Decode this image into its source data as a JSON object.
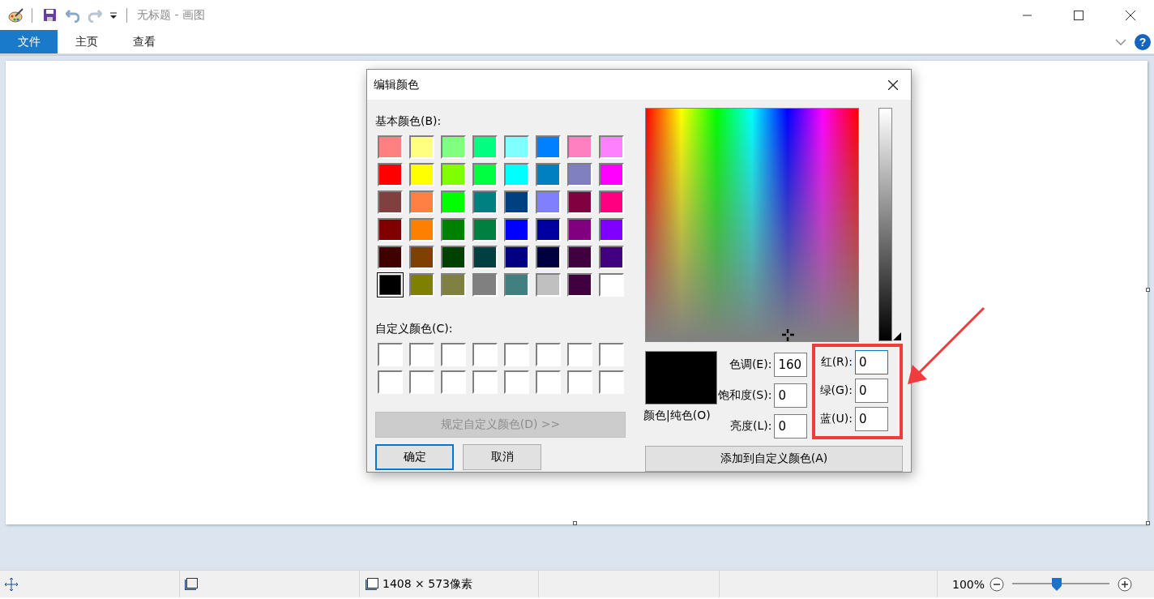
{
  "window": {
    "title": "无标题 - 画图",
    "help_label": "?"
  },
  "ribbon_tabs": [
    {
      "label": "文件",
      "selected": true
    },
    {
      "label": "主页",
      "selected": false
    },
    {
      "label": "查看",
      "selected": false
    }
  ],
  "dialog": {
    "title": "编辑颜色",
    "basic_colors_label": "基本颜色(B):",
    "basic_colors": [
      {
        "color": "#ff8080",
        "selected": false
      },
      {
        "color": "#ffff80",
        "selected": false
      },
      {
        "color": "#80ff80",
        "selected": false
      },
      {
        "color": "#00ff80",
        "selected": false
      },
      {
        "color": "#80ffff",
        "selected": false
      },
      {
        "color": "#0080ff",
        "selected": false
      },
      {
        "color": "#ff80c0",
        "selected": false
      },
      {
        "color": "#ff80ff",
        "selected": false
      },
      {
        "color": "#ff0000",
        "selected": false
      },
      {
        "color": "#ffff00",
        "selected": false
      },
      {
        "color": "#80ff00",
        "selected": false
      },
      {
        "color": "#00ff40",
        "selected": false
      },
      {
        "color": "#00ffff",
        "selected": false
      },
      {
        "color": "#0080c0",
        "selected": false
      },
      {
        "color": "#8080c0",
        "selected": false
      },
      {
        "color": "#ff00ff",
        "selected": false
      },
      {
        "color": "#804040",
        "selected": false
      },
      {
        "color": "#ff8040",
        "selected": false
      },
      {
        "color": "#00ff00",
        "selected": false
      },
      {
        "color": "#008080",
        "selected": false
      },
      {
        "color": "#004080",
        "selected": false
      },
      {
        "color": "#8080ff",
        "selected": false
      },
      {
        "color": "#800040",
        "selected": false
      },
      {
        "color": "#ff0080",
        "selected": false
      },
      {
        "color": "#800000",
        "selected": false
      },
      {
        "color": "#ff8000",
        "selected": false
      },
      {
        "color": "#008000",
        "selected": false
      },
      {
        "color": "#008040",
        "selected": false
      },
      {
        "color": "#0000ff",
        "selected": false
      },
      {
        "color": "#0000a0",
        "selected": false
      },
      {
        "color": "#800080",
        "selected": false
      },
      {
        "color": "#8000ff",
        "selected": false
      },
      {
        "color": "#400000",
        "selected": false
      },
      {
        "color": "#804000",
        "selected": false
      },
      {
        "color": "#004000",
        "selected": false
      },
      {
        "color": "#004040",
        "selected": false
      },
      {
        "color": "#000080",
        "selected": false
      },
      {
        "color": "#000040",
        "selected": false
      },
      {
        "color": "#400040",
        "selected": false
      },
      {
        "color": "#400080",
        "selected": false
      },
      {
        "color": "#000000",
        "selected": true
      },
      {
        "color": "#808000",
        "selected": false
      },
      {
        "color": "#808040",
        "selected": false
      },
      {
        "color": "#808080",
        "selected": false
      },
      {
        "color": "#408080",
        "selected": false
      },
      {
        "color": "#c0c0c0",
        "selected": false
      },
      {
        "color": "#400040",
        "selected": false
      },
      {
        "color": "#ffffff",
        "selected": false
      }
    ],
    "custom_colors_label": "自定义颜色(C):",
    "custom_colors": [
      {
        "color": "#ffffff"
      },
      {
        "color": "#ffffff"
      },
      {
        "color": "#ffffff"
      },
      {
        "color": "#ffffff"
      },
      {
        "color": "#ffffff"
      },
      {
        "color": "#ffffff"
      },
      {
        "color": "#ffffff"
      },
      {
        "color": "#ffffff"
      },
      {
        "color": "#ffffff"
      },
      {
        "color": "#ffffff"
      },
      {
        "color": "#ffffff"
      },
      {
        "color": "#ffffff"
      },
      {
        "color": "#ffffff"
      },
      {
        "color": "#ffffff"
      },
      {
        "color": "#ffffff"
      },
      {
        "color": "#ffffff"
      }
    ],
    "define_button": {
      "label": "规定自定义颜色(D) >>",
      "disabled": true
    },
    "ok_button": "确定",
    "cancel_button": "取消",
    "luminance": {
      "level": 0
    },
    "preview": {
      "color": "#000000"
    },
    "preview_label": "颜色|纯色(O)",
    "hsl_fields": [
      {
        "label": "色调(E):",
        "value": "160",
        "focused": false
      },
      {
        "label": "饱和度(S):",
        "value": "0",
        "focused": false
      },
      {
        "label": "亮度(L):",
        "value": "0",
        "focused": false
      }
    ],
    "rgb_fields": [
      {
        "label": "红(R):",
        "value": "0",
        "focused": true
      },
      {
        "label": "绿(G):",
        "value": "0",
        "focused": false
      },
      {
        "label": "蓝(U):",
        "value": "0",
        "focused": false
      }
    ],
    "add_button": "添加到自定义颜色(A)"
  },
  "status_bar": {
    "canvas_size": "1408 × 573像素",
    "zoom": "100%",
    "zoom_slider": {
      "level": 0.45
    }
  }
}
